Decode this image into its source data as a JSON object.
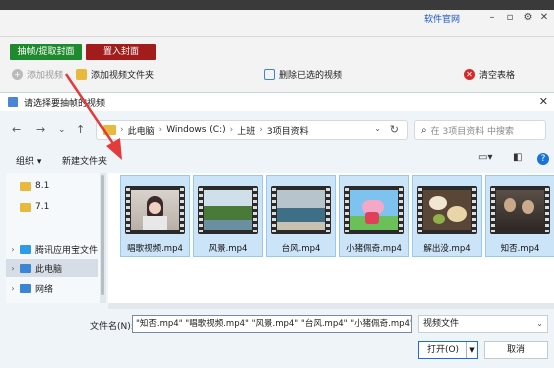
{
  "app": {
    "brand": "软件官网",
    "btn_extract": "抽帧/提取封面",
    "btn_import": "置入封面",
    "tool_add_video": "添加视频",
    "tool_add_folder": "添加视频文件夹",
    "tool_remove_processed": "删除已选的视频",
    "tool_clear": "清空表格"
  },
  "dialog": {
    "title": "请选择要抽帧的视频",
    "address": [
      "此电脑",
      "Windows (C:)",
      "上班",
      "3项目资料"
    ],
    "search_placeholder": "在 3项目资料 中搜索",
    "organize": "组织 ▾",
    "new_folder": "新建文件夹",
    "sidebar": [
      {
        "label": "8.1",
        "chevron": "",
        "color": "#e8b93c"
      },
      {
        "label": "7.1",
        "chevron": "",
        "color": "#e8b93c"
      },
      {
        "label": "腾讯应用宝文件",
        "chevron": "›",
        "color": "#2e9be6"
      },
      {
        "label": "此电脑",
        "chevron": "›",
        "color": "#3a86d4"
      },
      {
        "label": "网络",
        "chevron": "›",
        "color": "#3a86d4"
      }
    ],
    "files": [
      {
        "name": "唱歌视频.mp4",
        "thumb": "portrait"
      },
      {
        "name": "风景.mp4",
        "thumb": "landscape"
      },
      {
        "name": "台风.mp4",
        "thumb": "sea"
      },
      {
        "name": "小猪佩奇.mp4",
        "thumb": "peppa"
      },
      {
        "name": "解出没.mp4",
        "thumb": "food"
      },
      {
        "name": "知否.mp4",
        "thumb": "drama"
      }
    ],
    "filename_label": "文件名(N):",
    "filename_value": "\"知否.mp4\" \"唱歌视频.mp4\" \"风景.mp4\" \"台风.mp4\" \"小猪佩奇.mp4\" \"解",
    "filetype": "视频文件",
    "open_label": "打开(O)",
    "cancel_label": "取消"
  },
  "colors": {
    "accent": "#1a73d9",
    "green_button": "#1f8a2d",
    "red_button": "#a21c1c",
    "selection": "#cce4f7",
    "arrow": "#e23b3b"
  }
}
